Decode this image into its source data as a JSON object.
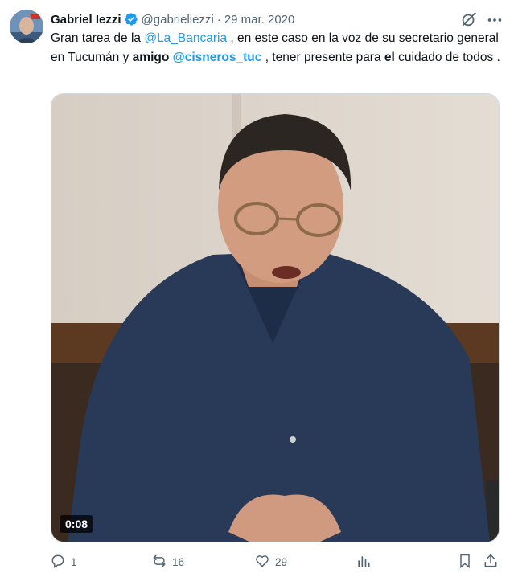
{
  "author": {
    "name": "Gabriel Iezzi",
    "handle": "@gabrieliezzi",
    "date": "29 mar. 2020"
  },
  "tweet": {
    "segments": [
      {
        "text": "Gran tarea de la ",
        "style": "plain"
      },
      {
        "text": "@La_Bancaria",
        "style": "mention"
      },
      {
        "text": " , en este caso en la voz de su secretario general en Tucumán y ",
        "style": "plain"
      },
      {
        "text": "amigo",
        "style": "bold"
      },
      {
        "text": " ",
        "style": "plain"
      },
      {
        "text": "@cisneros_tuc",
        "style": "mention-bold"
      },
      {
        "text": " , tener presente para ",
        "style": "plain"
      },
      {
        "text": "el",
        "style": "bold"
      },
      {
        "text": " cuidado de todos .",
        "style": "plain"
      }
    ]
  },
  "media": {
    "time": "0:08"
  },
  "actions": {
    "reply_count": "1",
    "retweet_count": "16",
    "like_count": "29"
  },
  "colors": {
    "accent": "#1d9bf0",
    "secondary_text": "#536471"
  }
}
